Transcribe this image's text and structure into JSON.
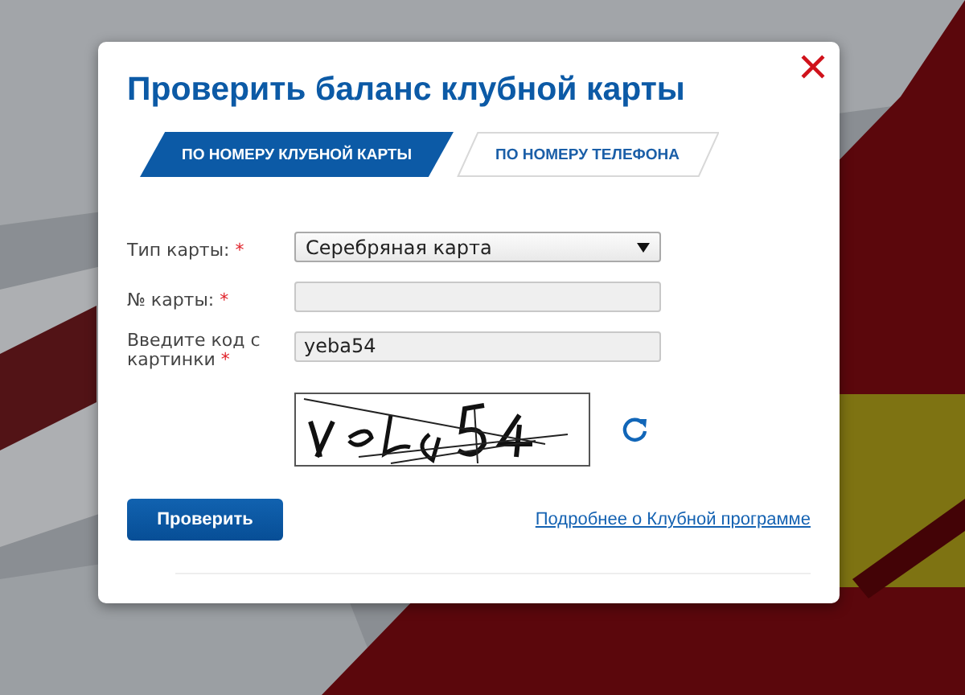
{
  "dialog": {
    "title": "Проверить баланс клубной карты"
  },
  "tabs": [
    {
      "label": "ПО НОМЕРУ КЛУБНОЙ КАРТЫ",
      "selected": true
    },
    {
      "label": "ПО НОМЕРУ ТЕЛЕФОНА",
      "selected": false
    }
  ],
  "fields": [
    {
      "kind": "select",
      "label": "Тип карты:",
      "required_mark": "*",
      "value": "Серебряная карта"
    },
    {
      "kind": "text",
      "label": "№ карты:",
      "required_mark": "*"
    },
    {
      "kind": "text",
      "label": "Введите код с картинки",
      "required_mark": "*",
      "value": "yeba54"
    },
    {
      "kind": "captcha"
    }
  ],
  "submit_button": "Проверить",
  "more_link": "Подробнее о Клубной программе"
}
